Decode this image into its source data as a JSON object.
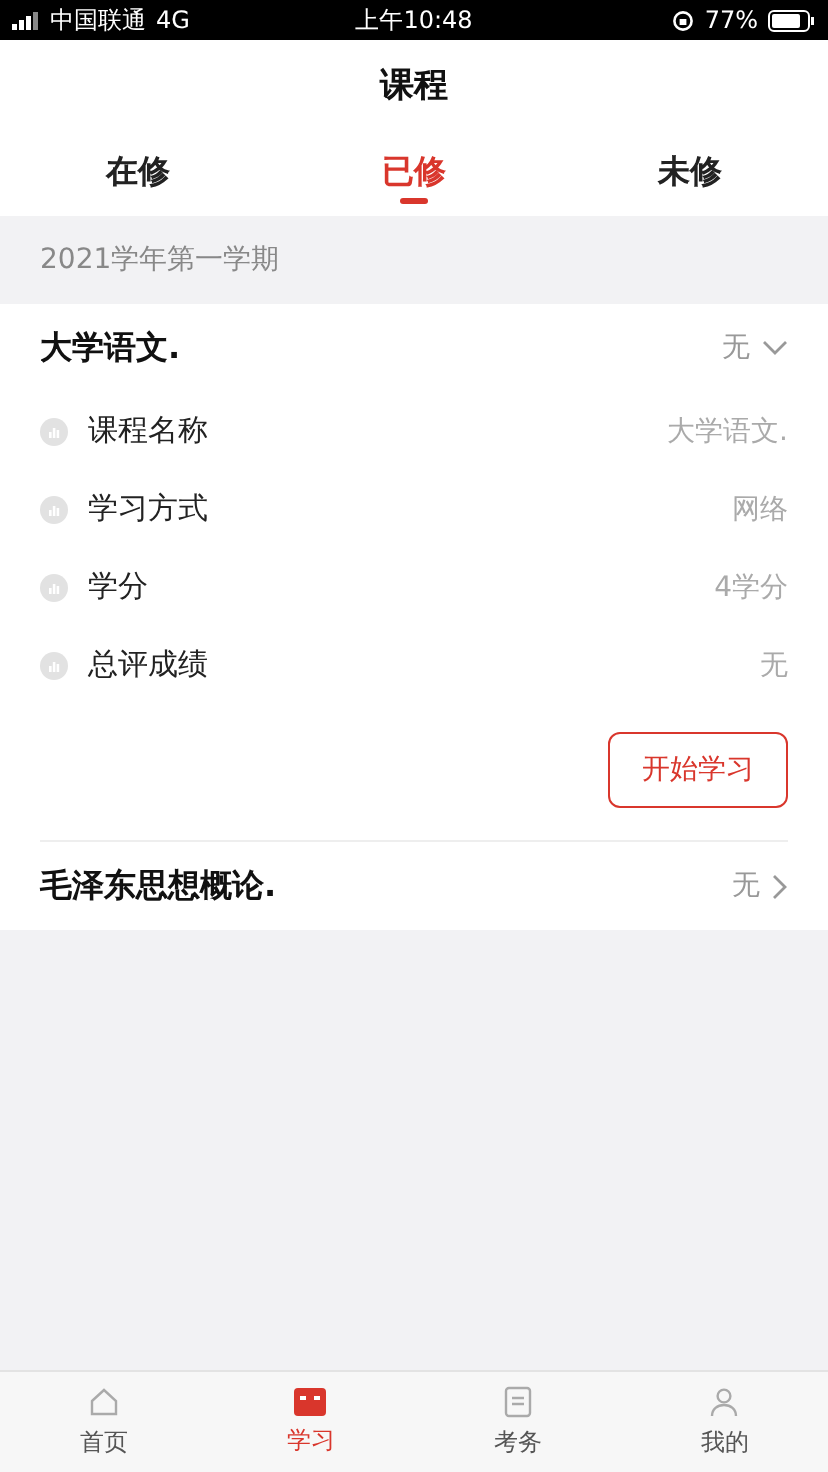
{
  "status_bar": {
    "carrier": "中国联通",
    "network": "4G",
    "time": "上午10:48",
    "battery": "77%"
  },
  "title": "课程",
  "tabs": [
    {
      "label": "在修",
      "selected": false
    },
    {
      "label": "已修",
      "selected": true
    },
    {
      "label": "未修",
      "selected": false
    }
  ],
  "term": "2021学年第一学期",
  "courses": [
    {
      "name": "大学语文.",
      "score": "无",
      "expanded": true,
      "details": [
        {
          "label": "课程名称",
          "value": "大学语文."
        },
        {
          "label": "学习方式",
          "value": "网络"
        },
        {
          "label": "学分",
          "value": "4学分"
        },
        {
          "label": "总评成绩",
          "value": "无"
        }
      ],
      "action": "开始学习"
    },
    {
      "name": "毛泽东思想概论.",
      "score": "无",
      "expanded": false
    }
  ],
  "bottom_nav": [
    {
      "label": "首页",
      "kind": "home",
      "selected": false
    },
    {
      "label": "学习",
      "kind": "study",
      "selected": true
    },
    {
      "label": "考务",
      "kind": "exam",
      "selected": false
    },
    {
      "label": "我的",
      "kind": "profile",
      "selected": false
    }
  ]
}
